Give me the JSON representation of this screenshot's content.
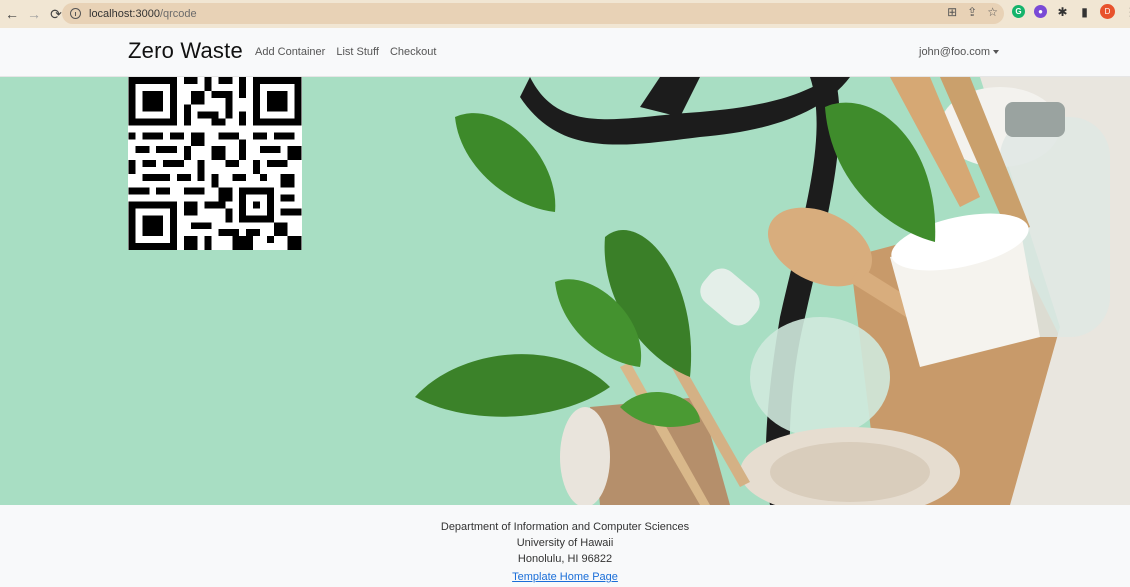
{
  "browser": {
    "url_host": "localhost:3000",
    "url_path": "/qrcode",
    "profile_initial": "D"
  },
  "navbar": {
    "brand": "Zero Waste",
    "links": [
      {
        "label": "Add Container"
      },
      {
        "label": "List Stuff"
      },
      {
        "label": "Checkout"
      }
    ],
    "user_email": "john@foo.com"
  },
  "footer": {
    "line1": "Department of Information and Computer Sciences",
    "line2": "University of Hawaii",
    "line3": "Honolulu, HI 96822",
    "link_label": "Template Home Page"
  },
  "colors": {
    "hero_background": "#a4dcc0",
    "leaf": "#3d8a2a",
    "link": "#1a6ed8"
  }
}
